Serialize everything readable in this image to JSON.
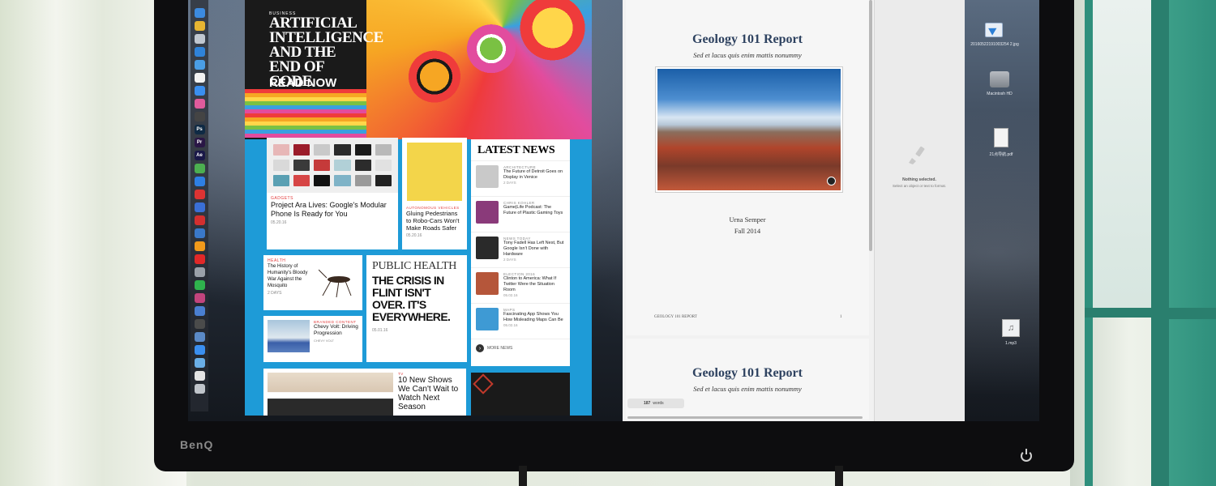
{
  "monitor": {
    "brand": "BenQ"
  },
  "dock": {
    "items": [
      {
        "name": "Finder",
        "glyph": "",
        "color": "#3c8be0"
      },
      {
        "name": "Chrome",
        "glyph": "",
        "color": "#e7b532"
      },
      {
        "name": "Launchpad",
        "glyph": "",
        "color": "#c0c7d0"
      },
      {
        "name": "Safari",
        "glyph": "",
        "color": "#2f83d9"
      },
      {
        "name": "Mail",
        "glyph": "",
        "color": "#4a9ee6"
      },
      {
        "name": "Calendar",
        "glyph": "",
        "color": "#f2f2f2"
      },
      {
        "name": "App Store",
        "glyph": "",
        "color": "#3a8ff0"
      },
      {
        "name": "Photos",
        "glyph": "",
        "color": "#e05b9c"
      },
      {
        "name": "Final Cut",
        "glyph": "",
        "color": "#444"
      },
      {
        "name": "Photoshop",
        "glyph": "Ps",
        "color": "#0f2a44"
      },
      {
        "name": "Premiere",
        "glyph": "Pr",
        "color": "#2a1746"
      },
      {
        "name": "After Effects",
        "glyph": "Ae",
        "color": "#1a1848"
      },
      {
        "name": "Chrome 2",
        "glyph": "",
        "color": "#4caf50"
      },
      {
        "name": "Keynote",
        "glyph": "",
        "color": "#2e7fe3"
      },
      {
        "name": "Red app",
        "glyph": "",
        "color": "#d33"
      },
      {
        "name": "Blue app",
        "glyph": "",
        "color": "#3a6fd6"
      },
      {
        "name": "NetEase",
        "glyph": "",
        "color": "#d32f2f"
      },
      {
        "name": "Image",
        "glyph": "",
        "color": "#3a78c9"
      },
      {
        "name": "Butterfly",
        "glyph": "",
        "color": "#f19a1b"
      },
      {
        "name": "Flipboard",
        "glyph": "",
        "color": "#e12828"
      },
      {
        "name": "Script",
        "glyph": "",
        "color": "#9aa0a8"
      },
      {
        "name": "Evernote",
        "glyph": "",
        "color": "#2fb34d"
      },
      {
        "name": "Pink",
        "glyph": "",
        "color": "#c2447d"
      },
      {
        "name": "Mail 2",
        "glyph": "",
        "color": "#4a7fd1"
      },
      {
        "name": "Dark",
        "glyph": "",
        "color": "#4b4b4b"
      },
      {
        "name": "Preview",
        "glyph": "",
        "color": "#5b8ac7"
      },
      {
        "name": "Safari 2",
        "glyph": "",
        "color": "#3a8ff0"
      },
      {
        "name": "Folder",
        "glyph": "",
        "color": "#6aaee6"
      },
      {
        "name": "Document",
        "glyph": "",
        "color": "#e4e4e4"
      },
      {
        "name": "Trash",
        "glyph": "",
        "color": "#bfc4ca"
      }
    ]
  },
  "magazine": {
    "hero": {
      "kicker": "BUSINESS",
      "title": "ARTIFICIAL INTELLIGENCE AND THE END OF CODE",
      "cta": "READ NOW"
    },
    "card_ara": {
      "kicker": "GADGETS",
      "title": "Project Ara Lives: Google's Modular Phone Is Ready for You",
      "date": "05.20.16"
    },
    "card_robo": {
      "kicker": "AUTONOMOUS VEHICLES",
      "title": "Gluing Pedestrians to Robo-Cars Won't Make Roads Safer",
      "date": "05.20.16"
    },
    "card_mosquito": {
      "kicker": "HEALTH",
      "title": "The History of Humanity's Bloody War Against the Mosquito",
      "date": "2 DAYS"
    },
    "card_flint": {
      "kicker": "PUBLIC HEALTH",
      "title": "THE CRISIS IN FLINT ISN'T OVER. IT'S EVERYWHERE.",
      "date": "05.01.16"
    },
    "card_volt": {
      "kicker": "BRANDED CONTENT",
      "title": "Chevy Volt: Driving Progression",
      "date": "CHEVY VOLT"
    },
    "card_tv": {
      "kicker": "TV",
      "title": "10 New Shows We Can't Wait to Watch Next Season"
    },
    "latest": {
      "title": "LATEST NEWS",
      "items": [
        {
          "cat": "ARCHITECTURE",
          "head": "The Future of Detroit Goes on Display in Venice",
          "date": "2 DAYS",
          "color": "#c9c9c9"
        },
        {
          "cat": "CHRIS KOHLER",
          "head": "Game|Life Podcast: The Future of Plastic Gaming Toys",
          "date": "",
          "color": "#8a3a7a"
        },
        {
          "cat": "NEWS TODAY",
          "head": "Tony Fadell Has Left Nest, But Google Isn't Done with Hardware",
          "date": "2 DAYS",
          "color": "#2a2a2a"
        },
        {
          "cat": "ELECTION 2016",
          "head": "Clinton to America: What If Twitter Were the Situation Room",
          "date": "05.02.16",
          "color": "#b5563a"
        },
        {
          "cat": "MAPS",
          "head": "Fascinating App Shows You How Misleading Maps Can Be",
          "date": "05.02.16",
          "color": "#3e9ad4"
        }
      ],
      "more": "MORE NEWS"
    }
  },
  "document": {
    "title": "Geology 101 Report",
    "subtitle": "Sed et lacus quis enim mattis nonummy",
    "author": "Urna Semper",
    "term": "Fall 2014",
    "footer_left": "GEOLOGY 101 REPORT",
    "footer_page": "1",
    "page2_title": "Geology 101 Report",
    "page2_subtitle": "Sed et lacus quis enim mattis nonummy",
    "word_count": "187",
    "word_label": "words"
  },
  "inspector": {
    "title": "Nothing selected.",
    "subtitle": "Select an object or text to format."
  },
  "desktop": {
    "files": [
      {
        "label": "20160522191003254 2.jpg"
      },
      {
        "label": "Macintosh HD"
      },
      {
        "label": "21点导航.pdf"
      },
      {
        "label": "1.mp3"
      }
    ]
  }
}
